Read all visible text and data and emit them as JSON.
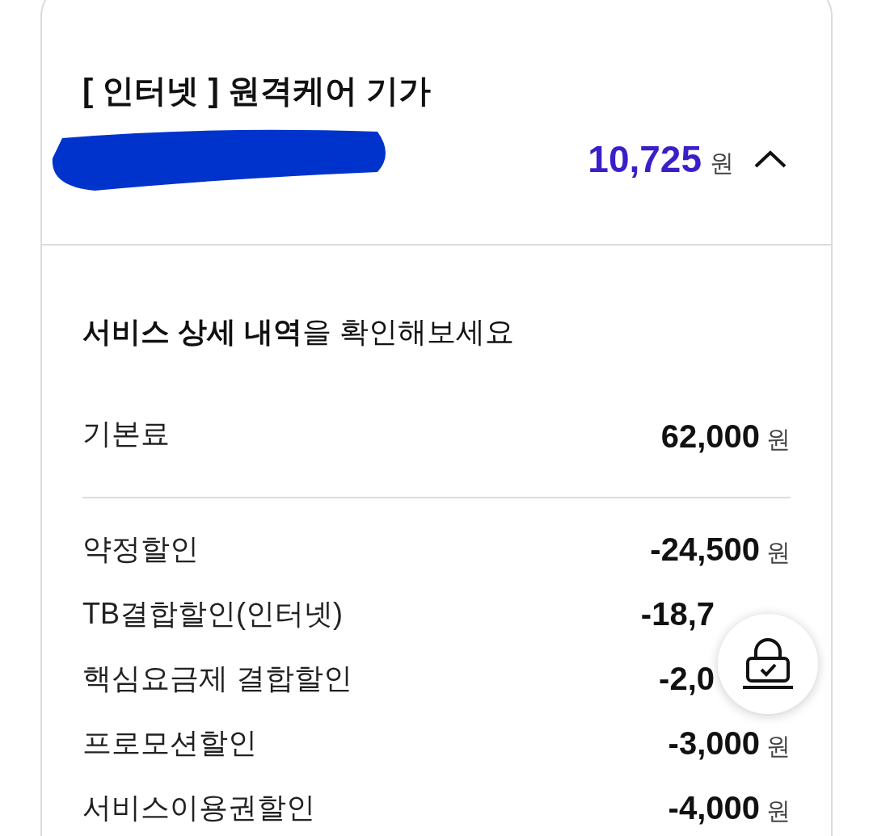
{
  "card": {
    "title": "[ 인터넷 ] 원격케어 기가",
    "amount": "10,725",
    "amount_unit": "원",
    "expanded": true
  },
  "details": {
    "heading": "**서비스 상세 내역**을 확인해보세요",
    "rows": [
      {
        "kind": "base",
        "label": "기본료",
        "value": "62,000",
        "unit": "원"
      },
      {
        "kind": "discount",
        "label": "약정할인",
        "value": "-24,500",
        "unit": "원"
      },
      {
        "kind": "discount",
        "label": "TB결합할인(인터넷)",
        "value": "-18,7"
      },
      {
        "kind": "discount",
        "label": "핵심요금제 결합할인",
        "value": "-2,0"
      },
      {
        "kind": "discount",
        "label": "프로모션할인",
        "value": "-3,000",
        "unit": "원"
      },
      {
        "kind": "discount",
        "label": "서비스이용권할인",
        "value": "-4,000",
        "unit": "원"
      }
    ]
  }
}
